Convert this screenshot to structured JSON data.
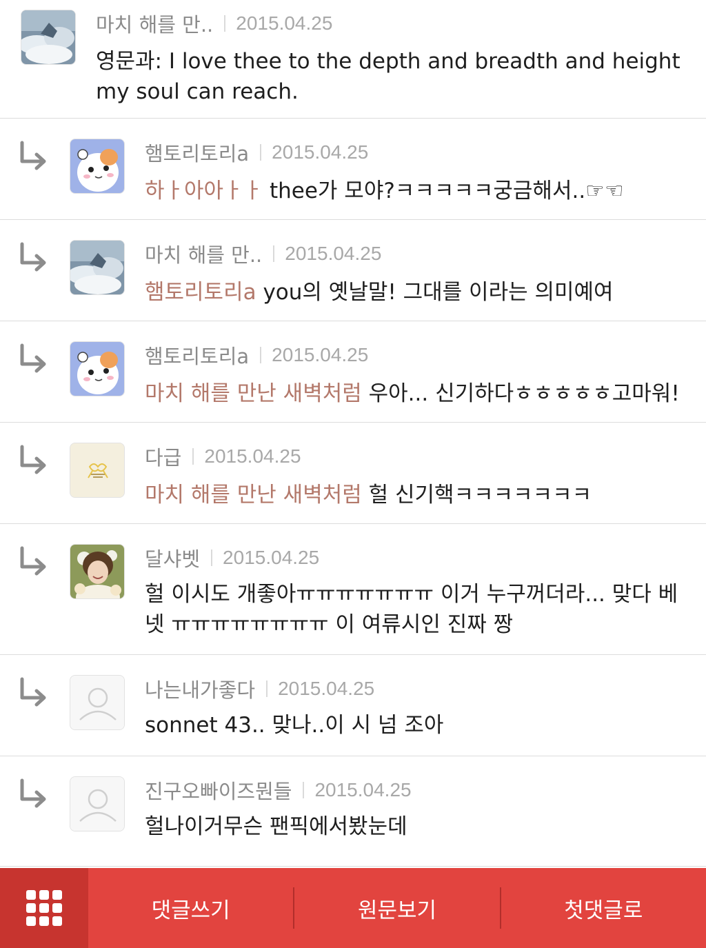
{
  "comments": [
    {
      "author": "마치 해를 만..",
      "date": "2015.04.25",
      "mention": "",
      "text": "영문과: I love thee to the depth and breadth and height my soul can reach.",
      "avatar_icon": "cloud-sky-avatar"
    },
    {
      "author": "햄토리토리a",
      "date": "2015.04.25",
      "mention": "하ㅏ아아ㅏㅏ",
      "text": " thee가 모야?ㅋㅋㅋㅋㅋ궁금해서..☞☜",
      "avatar_icon": "hamster-avatar"
    },
    {
      "author": "마치 해를 만..",
      "date": "2015.04.25",
      "mention": "햄토리토리a",
      "text": " you의 옛날말! 그대를 이라는 의미예여",
      "avatar_icon": "cloud-sky-avatar"
    },
    {
      "author": "햄토리토리a",
      "date": "2015.04.25",
      "mention": "마치 해를 만난 새벽처럼",
      "text": " 우아... 신기하다ㅎㅎㅎㅎㅎ고마워!",
      "avatar_icon": "hamster-avatar"
    },
    {
      "author": "다급",
      "date": "2015.04.25",
      "mention": "마치 해를 만난 새벽처럼",
      "text": " 헐 신기핵ㅋㅋㅋㅋㅋㅋㅋ",
      "avatar_icon": "ribbon-avatar"
    },
    {
      "author": "달샤벳",
      "date": "2015.04.25",
      "mention": "",
      "text": "헐 이시도 개좋아ㅠㅠㅠㅠㅠㅠㅠ 이거 누구꺼더라... 맞다 베넷 ㅠㅠㅠㅠㅠㅠㅠㅠ 이 여류시인 진짜 짱",
      "avatar_icon": "person-photo-avatar"
    },
    {
      "author": "나는내가좋다",
      "date": "2015.04.25",
      "mention": "",
      "text": "sonnet 43.. 맞나..이 시 넘 조아",
      "avatar_icon": "default-user-avatar"
    },
    {
      "author": "진구오빠이즈뭔들",
      "date": "2015.04.25",
      "mention": "",
      "text": "헐나이거무슨 팬픽에서봤눈데",
      "avatar_icon": "default-user-avatar"
    }
  ],
  "bottom_bar": {
    "menu_icon": "grid-menu-icon",
    "write_label": "댓글쓰기",
    "original_label": "원문보기",
    "first_label": "첫댓글로"
  },
  "colors": {
    "bar": "#e2443f",
    "bar_menu": "#c7342f",
    "mention": "#b3786a"
  }
}
